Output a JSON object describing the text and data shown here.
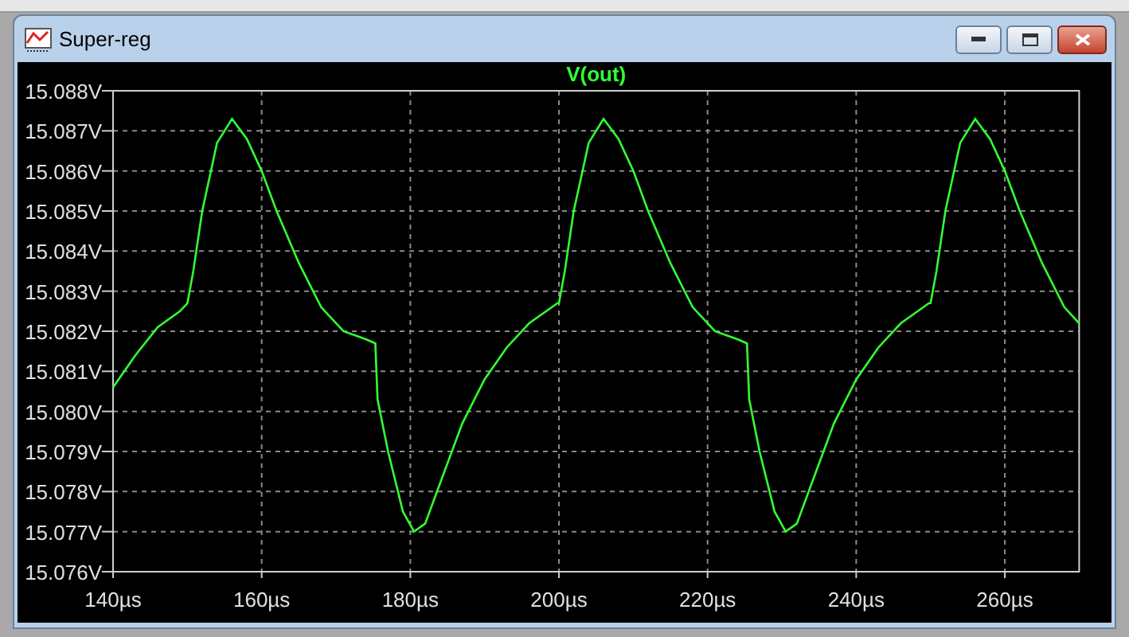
{
  "window": {
    "title": "Super-reg"
  },
  "plot": {
    "chart_data": {
      "type": "line",
      "grid": true,
      "x": [
        140,
        143,
        146,
        149,
        150,
        150.8,
        152,
        154,
        156,
        158,
        160,
        162,
        165,
        168,
        171,
        174,
        175.3,
        175.6,
        177,
        179,
        180.5,
        182,
        184,
        187,
        190,
        193,
        196,
        199.8,
        200,
        200.8,
        202,
        204,
        206,
        208,
        210,
        212,
        215,
        218,
        221,
        224,
        225.3,
        225.6,
        227,
        229,
        230.5,
        232,
        234,
        237,
        240,
        243,
        246,
        249.8,
        250,
        250.8,
        252,
        254,
        256,
        258,
        260,
        262,
        265,
        268,
        270
      ],
      "series": [
        {
          "name": "V(out)",
          "color": "#33ff33",
          "values": [
            15.0806,
            15.0814,
            15.0821,
            15.0825,
            15.0827,
            15.0835,
            15.085,
            15.0867,
            15.0873,
            15.0868,
            15.086,
            15.085,
            15.0837,
            15.0826,
            15.082,
            15.0818,
            15.0817,
            15.0803,
            15.079,
            15.0775,
            15.077,
            15.0772,
            15.0782,
            15.0797,
            15.0808,
            15.0816,
            15.0822,
            15.0827,
            15.0827,
            15.0835,
            15.085,
            15.0867,
            15.0873,
            15.0868,
            15.086,
            15.085,
            15.0837,
            15.0826,
            15.082,
            15.0818,
            15.0817,
            15.0803,
            15.079,
            15.0775,
            15.077,
            15.0772,
            15.0782,
            15.0797,
            15.0808,
            15.0816,
            15.0822,
            15.0827,
            15.0827,
            15.0835,
            15.085,
            15.0867,
            15.0873,
            15.0868,
            15.086,
            15.085,
            15.0837,
            15.0826,
            15.0822
          ]
        }
      ],
      "xlim": [
        140,
        270
      ],
      "ylim": [
        15.076,
        15.088
      ],
      "xticks": [
        {
          "value": 140,
          "label": "140µs"
        },
        {
          "value": 160,
          "label": "160µs"
        },
        {
          "value": 180,
          "label": "180µs"
        },
        {
          "value": 200,
          "label": "200µs"
        },
        {
          "value": 220,
          "label": "220µs"
        },
        {
          "value": 240,
          "label": "240µs"
        },
        {
          "value": 260,
          "label": "260µs"
        }
      ],
      "yticks": [
        {
          "value": 15.076,
          "label": "15.076V"
        },
        {
          "value": 15.077,
          "label": "15.077V"
        },
        {
          "value": 15.078,
          "label": "15.078V"
        },
        {
          "value": 15.079,
          "label": "15.079V"
        },
        {
          "value": 15.08,
          "label": "15.080V"
        },
        {
          "value": 15.081,
          "label": "15.081V"
        },
        {
          "value": 15.082,
          "label": "15.082V"
        },
        {
          "value": 15.083,
          "label": "15.083V"
        },
        {
          "value": 15.084,
          "label": "15.084V"
        },
        {
          "value": 15.085,
          "label": "15.085V"
        },
        {
          "value": 15.086,
          "label": "15.086V"
        },
        {
          "value": 15.087,
          "label": "15.087V"
        },
        {
          "value": 15.088,
          "label": "15.088V"
        }
      ]
    }
  }
}
